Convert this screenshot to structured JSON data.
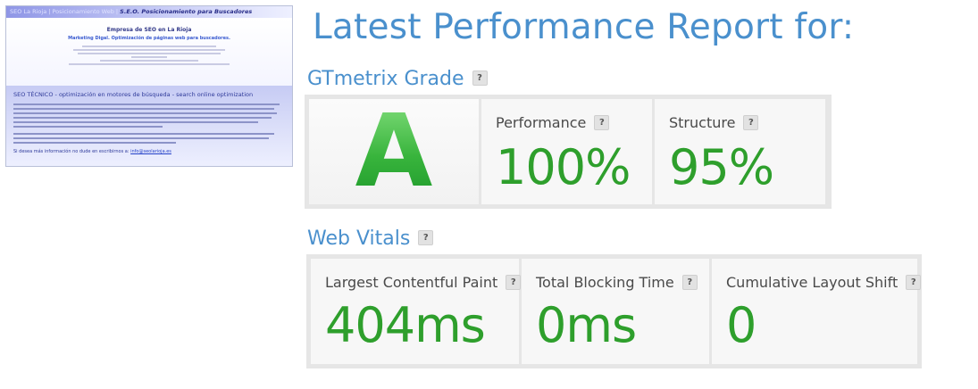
{
  "thumbnail": {
    "bar_left": "SEO La Rioja | Posicionamiento Web |",
    "bar_right": "S.E.O. Posicionamiento para Buscadores",
    "heading": "Empresa de SEO en La Rioja",
    "subheading": "Marketing Digal. Optimización de páginas web para buscadores.",
    "section_heading": "SEO TÉCNICO - optimización en motores de búsqueda - search online optimization",
    "contact_prefix": "Si desea más información no dude en escribirnos a:",
    "contact_email": "info@seolarioja.es"
  },
  "report": {
    "title": "Latest Performance Report for:"
  },
  "gtmetrix": {
    "label": "GTmetrix Grade",
    "help": "?",
    "grade": "A",
    "performance_label": "Performance",
    "performance_value": "100%",
    "structure_label": "Structure",
    "structure_value": "95%"
  },
  "web_vitals": {
    "label": "Web Vitals",
    "help": "?",
    "lcp_label": "Largest Contentful Paint",
    "lcp_value": "404ms",
    "tbt_label": "Total Blocking Time",
    "tbt_value": "0ms",
    "cls_label": "Cumulative Layout Shift",
    "cls_value": "0"
  },
  "colors": {
    "heading": "#4a90cd",
    "good_value": "#2e9f2c",
    "grade_a": "#38b43c",
    "panel_bg": "#e6e6e6"
  }
}
